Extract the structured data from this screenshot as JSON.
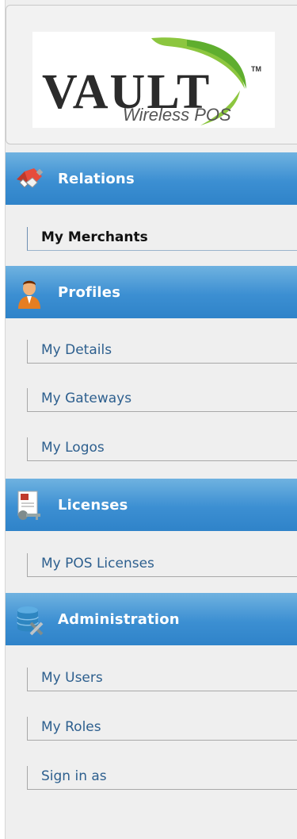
{
  "logo": {
    "brand": "VAULT",
    "tagline": "Wireless POS",
    "trademark": "TM"
  },
  "sections": [
    {
      "title": "Relations",
      "icon": "handshake-icon",
      "items": [
        {
          "label": "My Merchants",
          "active": true
        }
      ]
    },
    {
      "title": "Profiles",
      "icon": "user-icon",
      "items": [
        {
          "label": "My Details"
        },
        {
          "label": "My Gateways"
        },
        {
          "label": "My Logos"
        }
      ]
    },
    {
      "title": "Licenses",
      "icon": "license-key-icon",
      "items": [
        {
          "label": "My POS Licenses"
        }
      ]
    },
    {
      "title": "Administration",
      "icon": "database-admin-icon",
      "items": [
        {
          "label": "My Users"
        },
        {
          "label": "My Roles"
        },
        {
          "label": "Sign in as"
        }
      ]
    }
  ],
  "colors": {
    "header_blue": "#3c8fd2",
    "link_blue": "#2d5f8e",
    "sidebar_bg": "#efefef"
  }
}
